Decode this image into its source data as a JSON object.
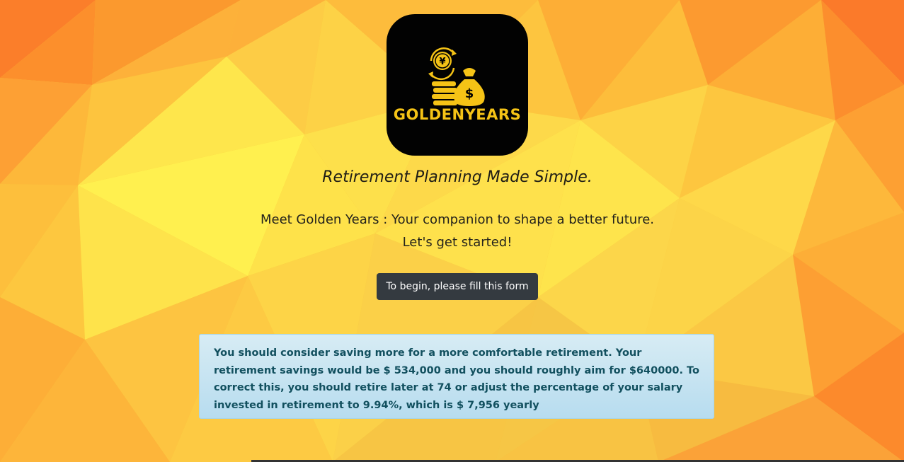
{
  "logo": {
    "icon_name": "money-bag-coins-icon",
    "wordmark": "GOLDENYEARS",
    "bag_symbol": "$",
    "coin_symbol": "¥",
    "accent_color": "#f5c316",
    "background_color": "#020202"
  },
  "hero": {
    "tagline": "Retirement Planning Made Simple.",
    "intro_line1": "Meet Golden Years : Your companion to shape a better future.",
    "intro_line2": "Let's get started!"
  },
  "cta": {
    "label": "To begin, please fill this form",
    "color": "#343a40"
  },
  "alert": {
    "message": "You should consider saving more for a more comfortable retirement. Your retirement savings would be $ 534,000 and you should roughly aim for $640000. To correct this, you should retire later at 74 or adjust the percentage of your salary invested in retirement to 9.94%, which is $ 7,956 yearly",
    "text_color": "#12505f",
    "background_color": "#c8e4f2"
  },
  "background": {
    "style": "low-poly-triangles",
    "colors": [
      "#fb8a2a",
      "#fdb23a",
      "#fde34d",
      "#fff04f"
    ]
  }
}
